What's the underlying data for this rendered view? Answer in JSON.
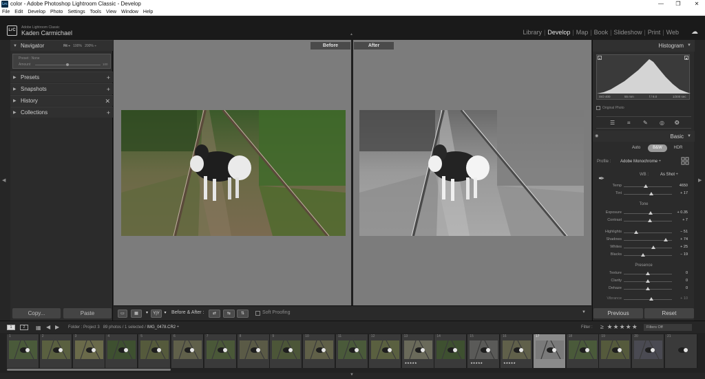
{
  "window": {
    "title": "color - Adobe Photoshop Lightroom Classic - Develop",
    "app_icon": "Lrc",
    "minimize": "—",
    "maximize": "❐",
    "close": "✕"
  },
  "menu": [
    "File",
    "Edit",
    "Develop",
    "Photo",
    "Settings",
    "Tools",
    "View",
    "Window",
    "Help"
  ],
  "identity": {
    "logo": "LrC",
    "app_name": "Adobe Lightroom Classic",
    "user": "Kaden Carmichael"
  },
  "modules": [
    "Library",
    "Develop",
    "Map",
    "Book",
    "Slideshow",
    "Print",
    "Web"
  ],
  "active_module": "Develop",
  "left_panel": {
    "navigator": {
      "label": "Navigator",
      "zoom_options": [
        "Fit ÷",
        "100%",
        "200% ÷"
      ]
    },
    "preset_preview": {
      "line1": "Preset : None",
      "line2": "Amount",
      "value": "100"
    },
    "sections": [
      {
        "label": "Presets",
        "action": "+"
      },
      {
        "label": "Snapshots",
        "action": "+"
      },
      {
        "label": "History",
        "action": "✕"
      },
      {
        "label": "Collections",
        "action": "+"
      }
    ],
    "copy_label": "Copy...",
    "paste_label": "Paste"
  },
  "center": {
    "before_label": "Before",
    "after_label": "After"
  },
  "toolbar": {
    "view_yy": "Y|Y",
    "before_after_label": "Before & After :",
    "soft_proofing": "Soft Proofing"
  },
  "right_panel": {
    "histogram_label": "Histogram",
    "histo_info": [
      "ISO 400",
      "55 mm",
      "f / 8.0",
      "1/200 sec"
    ],
    "original_photo": "Original Photo",
    "basic_label": "Basic",
    "modes": [
      "Auto",
      "B&W",
      "HDR"
    ],
    "profile_label": "Profile :",
    "profile_value": "Adobe Monochrome ÷",
    "wb_label": "WB :",
    "wb_value": "As Shot ÷",
    "wb_sliders": [
      {
        "label": "Temp",
        "value": "4650",
        "pos": 0.45
      },
      {
        "label": "Tint",
        "value": "+ 17",
        "pos": 0.57
      }
    ],
    "tone_label": "Tone",
    "tone_sliders": [
      {
        "label": "Exposure",
        "value": "+ 0.35",
        "pos": 0.55
      },
      {
        "label": "Contrast",
        "value": "+ 7",
        "pos": 0.54
      }
    ],
    "tone_sliders_2": [
      {
        "label": "Highlights",
        "value": "− 51",
        "pos": 0.25
      },
      {
        "label": "Shadows",
        "value": "+ 74",
        "pos": 0.87
      },
      {
        "label": "Whites",
        "value": "+ 25",
        "pos": 0.62
      },
      {
        "label": "Blacks",
        "value": "− 19",
        "pos": 0.4
      }
    ],
    "presence_label": "Presence",
    "presence_sliders": [
      {
        "label": "Texture",
        "value": "0",
        "pos": 0.5
      },
      {
        "label": "Clarity",
        "value": "0",
        "pos": 0.5
      },
      {
        "label": "Dehaze",
        "value": "0",
        "pos": 0.5
      }
    ],
    "vibrance": {
      "label": "Vibrance",
      "value": "+ 10",
      "pos": 0.57
    },
    "previous_label": "Previous",
    "reset_label": "Reset"
  },
  "filmstrip_bar": {
    "screen1": "1",
    "screen2": "2",
    "folder_text": "Folder : Project 3",
    "count_text": "89 photos / 1 selected /",
    "filename": "IMG_0478.CR2 ÷",
    "filter_label": "Filter :",
    "stars": "≥ ★★★★★",
    "filters_off": "Filters Off"
  },
  "filmstrip": {
    "cells": [
      {
        "num": "1",
        "rating": ""
      },
      {
        "num": "2",
        "rating": ""
      },
      {
        "num": "3",
        "rating": ""
      },
      {
        "num": "4",
        "rating": ""
      },
      {
        "num": "5",
        "rating": ""
      },
      {
        "num": "6",
        "rating": ""
      },
      {
        "num": "7",
        "rating": ""
      },
      {
        "num": "8",
        "rating": ""
      },
      {
        "num": "9",
        "rating": ""
      },
      {
        "num": "10",
        "rating": ""
      },
      {
        "num": "11",
        "rating": ""
      },
      {
        "num": "12",
        "rating": ""
      },
      {
        "num": "13",
        "rating": "★★★★★"
      },
      {
        "num": "14",
        "rating": ""
      },
      {
        "num": "15",
        "rating": "★★★★★"
      },
      {
        "num": "16",
        "rating": "★★★★★"
      },
      {
        "num": "17",
        "rating": ""
      },
      {
        "num": "18",
        "rating": ""
      },
      {
        "num": "19",
        "rating": ""
      },
      {
        "num": "20",
        "rating": ""
      },
      {
        "num": "21",
        "rating": ""
      }
    ],
    "selected_index": 16
  }
}
